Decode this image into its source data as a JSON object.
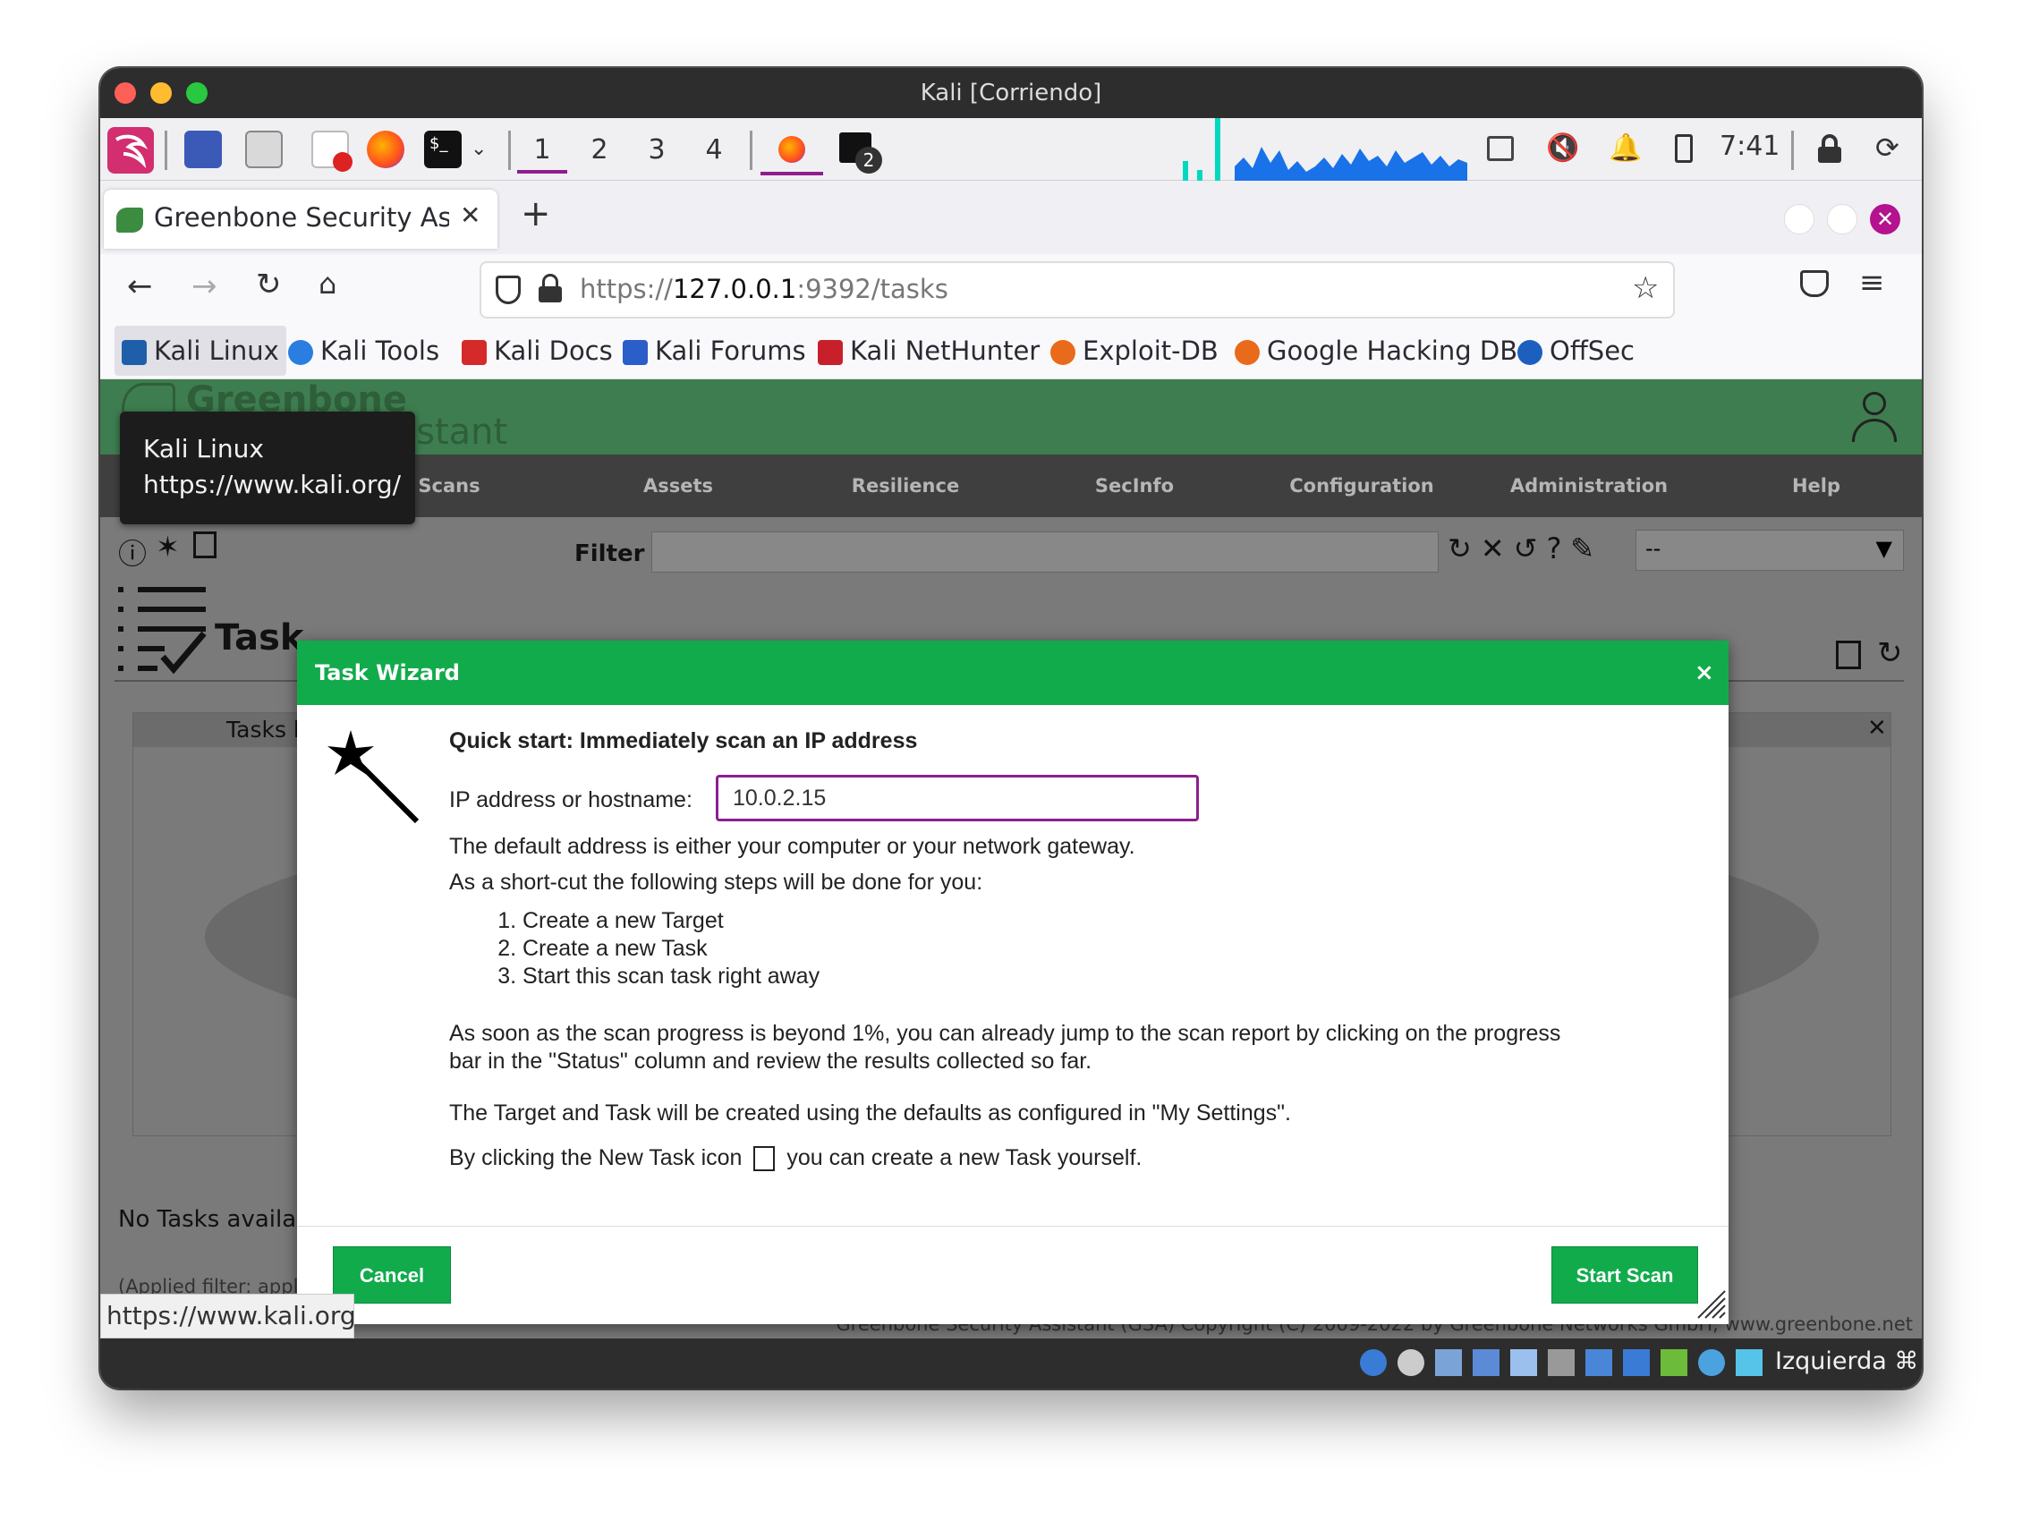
{
  "window": {
    "title": "Kali [Corriendo]"
  },
  "panel": {
    "workspaces": [
      "1",
      "2",
      "3",
      "4"
    ],
    "terminal_badge": "2",
    "clock": "7:41"
  },
  "browser": {
    "tab_title": "Greenbone Security Assist",
    "new_tab": "+",
    "url_prefix": "https://",
    "url_host": "127.0.0.1",
    "url_rest": ":9392/tasks",
    "bookmarks": [
      "Kali Linux",
      "Kali Tools",
      "Kali Docs",
      "Kali Forums",
      "Kali NetHunter",
      "Exploit-DB",
      "Google Hacking DB",
      "OffSec"
    ]
  },
  "tooltip": {
    "line1": "Kali Linux",
    "line2": "https://www.kali.org/"
  },
  "gsa": {
    "logo_line1": "Greenbone",
    "logo_line2": "Security Assistant",
    "menu": [
      "Scans",
      "Assets",
      "Resilience",
      "SecInfo",
      "Configuration",
      "Administration",
      "Help"
    ],
    "filter_label": "Filter",
    "filter_select": "--",
    "page_title": "Task",
    "panel_title": "Tasks b",
    "no_tasks": "No Tasks availab",
    "applied_filter": "(Applied filter: apply_overrides=0 min_qod=70 sort=name first=1 rows=10)",
    "copyright": "Greenbone Security Assistant (GSA) Copyright (C) 2009-2022 by Greenbone Networks GmbH, www.greenbone.net"
  },
  "modal": {
    "title": "Task Wizard",
    "close": "×",
    "heading": "Quick start: Immediately scan an IP address",
    "ip_label": "IP address or hostname:",
    "ip_value": "10.0.2.15",
    "default_text": "The default address is either your computer or your network gateway.",
    "shortcut_text": "As a short-cut the following steps will be done for you:",
    "steps": [
      "Create a new Target",
      "Create a new Task",
      "Start this scan task right away"
    ],
    "progress_text_1": "As soon as the scan progress is beyond 1%, you can already jump to the scan report by clicking on the progress",
    "progress_text_2": "bar in the \"Status\" column and review the results collected so far.",
    "settings_text": "The Target and Task will be created using the defaults as configured in \"My Settings\".",
    "newtask_before": "By clicking the New Task icon",
    "newtask_after": "you can create a new Task yourself.",
    "cancel": "Cancel",
    "start": "Start Scan"
  },
  "status_link": "https://www.kali.org",
  "vbox": {
    "host_key": "Izquierda ⌘"
  }
}
